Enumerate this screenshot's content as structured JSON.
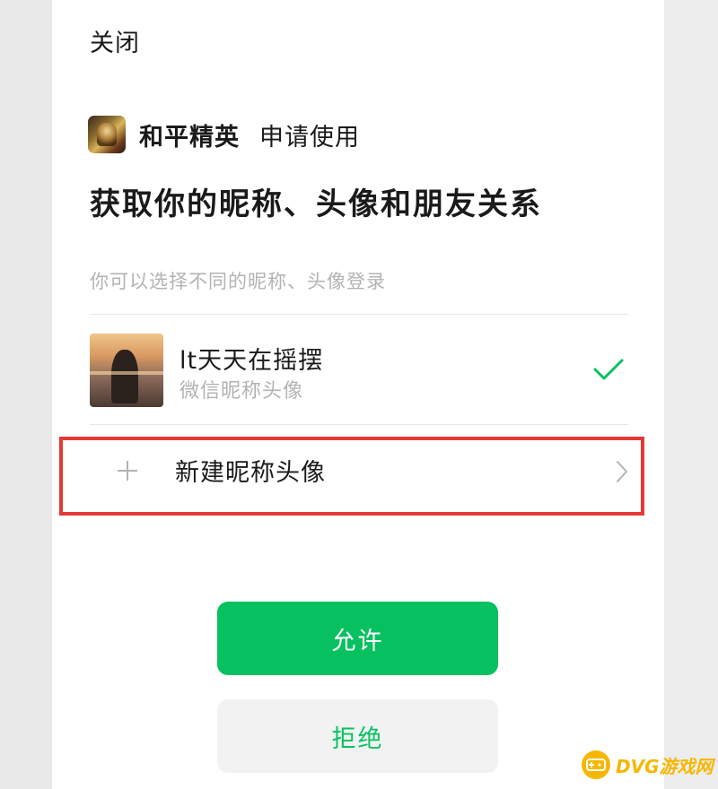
{
  "header": {
    "close_label": "关闭"
  },
  "app": {
    "icon": "game-app-icon",
    "name": "和平精英",
    "request_text": "申请使用"
  },
  "permission": {
    "title": "获取你的昵称、头像和朋友关系",
    "hint": "你可以选择不同的昵称、头像登录"
  },
  "profile_option": {
    "name": "lt天天在摇摆",
    "subtitle": "微信昵称头像",
    "selected": true,
    "check_icon": "check-icon"
  },
  "new_profile": {
    "icon": "plus-icon",
    "label": "新建昵称头像",
    "chevron": "chevron-right-icon",
    "highlight_color": "#e53935"
  },
  "actions": {
    "allow_label": "允许",
    "deny_label": "拒绝"
  },
  "colors": {
    "accent": "#07c160",
    "deny_bg": "#f2f2f2",
    "watermark": "#f5b700"
  },
  "watermark": {
    "text": "DVG游戏网"
  }
}
